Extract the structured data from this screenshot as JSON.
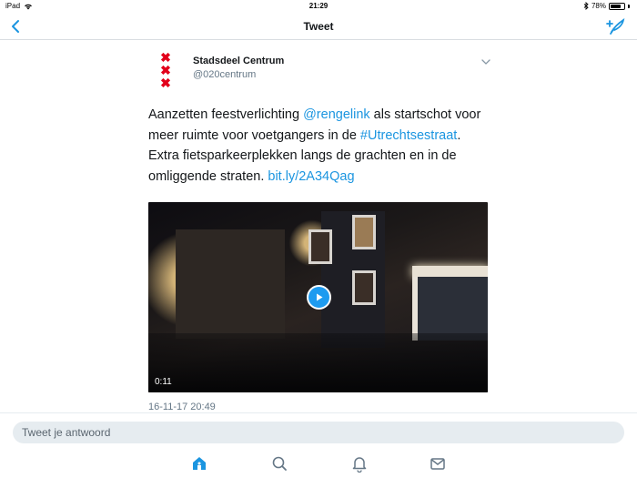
{
  "status_bar": {
    "device": "iPad",
    "time": "21:29",
    "battery_percent": "78%",
    "battery_level": 0.78
  },
  "nav": {
    "title": "Tweet",
    "back_icon": "chevron-left-icon",
    "compose_icon": "compose-tweet-icon"
  },
  "tweet": {
    "author_name": "Stadsdeel Centrum",
    "author_handle": "@020centrum",
    "text_parts": {
      "t1": "Aanzetten feestverlichting ",
      "mention": "@rengelink",
      "t2": " als startschot voor meer ruimte voor voetgangers in de ",
      "hashtag": "#Utrechtsestraat",
      "t3": ". Extra fietsparkeerplekken langs de grachten en in de omliggende straten. ",
      "link": "bit.ly/2A34Qag"
    },
    "video_duration": "0:11",
    "timestamp": "16-11-17 20:49"
  },
  "reply": {
    "placeholder": "Tweet je antwoord"
  },
  "tabs": [
    {
      "name": "home",
      "icon": "home-icon",
      "active": true
    },
    {
      "name": "search",
      "icon": "search-icon",
      "active": false
    },
    {
      "name": "notifications",
      "icon": "bell-icon",
      "active": false
    },
    {
      "name": "messages",
      "icon": "mail-icon",
      "active": false
    }
  ],
  "colors": {
    "accent": "#1b95e0",
    "brand_red": "#e2001a",
    "muted": "#657786"
  }
}
